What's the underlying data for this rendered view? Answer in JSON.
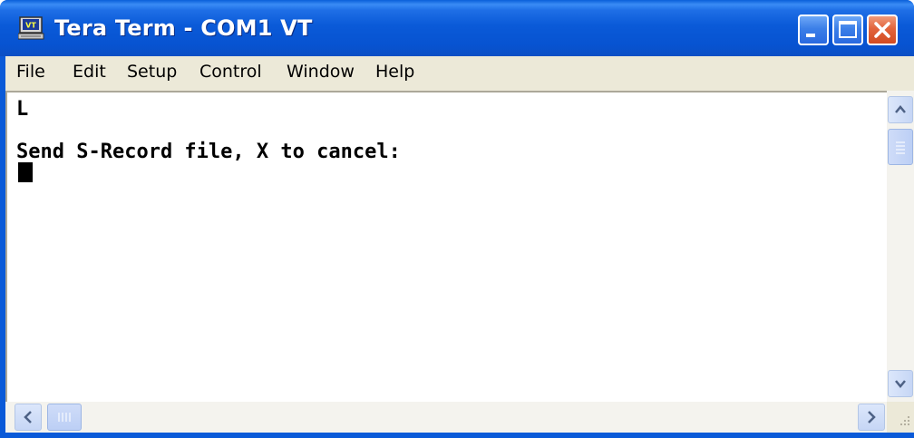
{
  "window": {
    "title": "Tera Term - COM1 VT",
    "app_icon": "vt-terminal-icon",
    "controls": {
      "minimize": "minimize-icon",
      "maximize": "maximize-icon",
      "close": "close-icon"
    }
  },
  "menu": {
    "items": [
      {
        "label": "File"
      },
      {
        "label": "Edit"
      },
      {
        "label": "Setup"
      },
      {
        "label": "Control"
      },
      {
        "label": "Window"
      },
      {
        "label": "Help"
      }
    ]
  },
  "terminal": {
    "lines": [
      "L",
      "",
      "Send S-Record file, X to cancel:"
    ]
  },
  "colors": {
    "titlebar": "#0a5ad8",
    "close_button": "#e2643c",
    "menubar": "#ece9d8",
    "terminal_bg": "#ffffff",
    "terminal_text": "#000000"
  }
}
